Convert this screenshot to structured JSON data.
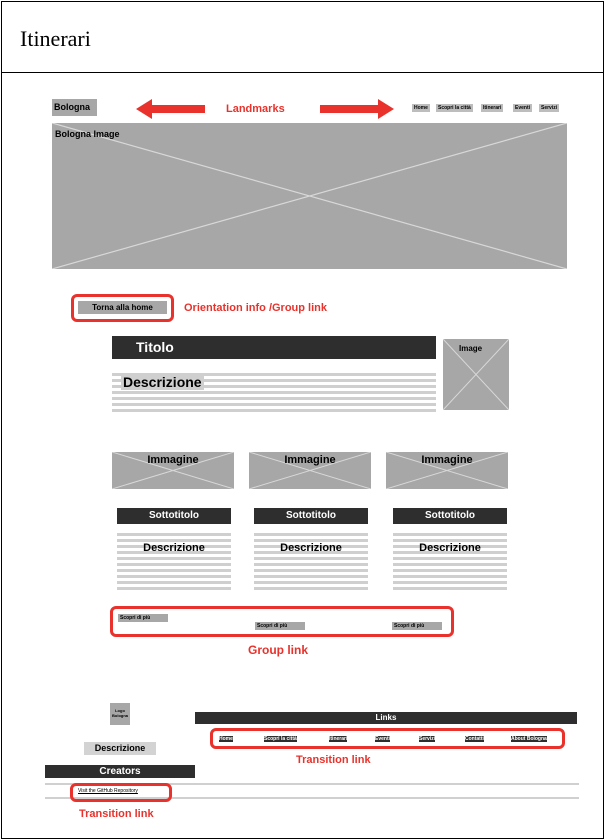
{
  "page": {
    "title": "Itinerari"
  },
  "header": {
    "logo": "Bologna",
    "annotation": "Landmarks",
    "nav": [
      "Home",
      "Scopri la città",
      "Itinerari",
      "Eventi",
      "Servizi"
    ]
  },
  "hero": {
    "label": "Bologna Image"
  },
  "back": {
    "label": "Torna alla home",
    "annotation": "Orientation info /Group link"
  },
  "intro": {
    "title": "Titolo",
    "description": "Descrizione",
    "image": "Image"
  },
  "cards": [
    {
      "image": "Immagine",
      "subtitle": "Sottotitolo",
      "description": "Descrizione",
      "link": "Scopri di più"
    },
    {
      "image": "Immagine",
      "subtitle": "Sottotitolo",
      "description": "Descrizione",
      "link": "Scopri di più"
    },
    {
      "image": "Immagine",
      "subtitle": "Sottotitolo",
      "description": "Descrizione",
      "link": "Scopri di più"
    }
  ],
  "cards_annotation": "Group link",
  "footer": {
    "logo": "Logo Bologna",
    "description": "Descrizione",
    "creators": "Creators",
    "repo_link": "Visit the GitHub Repository",
    "repo_annotation": "Transition link",
    "links_title": "Links",
    "links": [
      "Home",
      "Scopri la città",
      "Itinerari",
      "Eventi",
      "Servizi",
      "Contatti",
      "About Bologna"
    ],
    "links_annotation": "Transition link"
  },
  "colors": {
    "annotation": "#e8322b",
    "placeholder": "#a7a7a7",
    "dark": "#2e2e2e"
  }
}
